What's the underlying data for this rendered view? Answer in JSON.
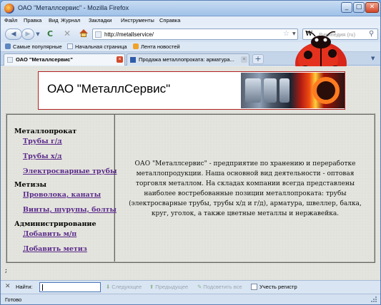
{
  "window": {
    "title": "ОАО \"Металлсервис\" - Mozilla Firefox",
    "minimize": "_",
    "maximize": "□",
    "close": "✕"
  },
  "menu": [
    "Файл",
    "Правка",
    "Вид",
    "Журнал",
    "Закладки",
    "Инструменты",
    "Справка"
  ],
  "nav": {
    "back": "◀",
    "forward": "▶",
    "dropdown": "▼",
    "reload": "C",
    "stop": "✕",
    "url": "http://metallservice/",
    "star": "☆",
    "url_dropdown": "▼",
    "search_engine": "W",
    "search_placeholder": "Википедия (ru)",
    "search_button": "⚲"
  },
  "bookmarks": [
    "Самые популярные",
    "Начальная страница",
    "Лента новостей"
  ],
  "tabs": [
    {
      "label": "ОАО \"Металлсервис\"",
      "close": "×"
    },
    {
      "label": "Продажа металлопроката: арматура...",
      "close": "×"
    }
  ],
  "new_tab": "+",
  "tab_list": "▼",
  "page": {
    "company": "ОАО \"МеталлСервис\"",
    "sidebar": {
      "cat_metalprokat": "Металлопрокат",
      "link_pipes_gd": "Трубы г/д",
      "link_pipes_hd": "Трубы х/д",
      "link_welded": "Электросварные трубы",
      "cat_metizy": "Метизы",
      "link_wire": "Проволока, канаты",
      "link_screws": "Винты, шурупы, болты",
      "cat_admin": "Администрирование",
      "link_add_mp": "Добавить м/п",
      "link_add_metiz": "Добавить метиз"
    },
    "intro": "ОАО \"Металлсервис\" - предприятие по хранению и переработке металлопродукции. Наша основной вид деятельности - оптовая торговля металлом. На складах компании всегда представлены наиболее востребованные позиции металлопроката: трубы (электросварные трубы, трубы х/д и г/д), арматура, швеллер, балка, круг, уголок, а также цветные металлы и нержавейка.",
    "trailing": ";"
  },
  "findbar": {
    "close": "✕",
    "label": "Найти:",
    "value": "",
    "next": "Следующее",
    "prev": "Предыдущее",
    "highlight": "Подсветить все",
    "match_case": "Учесть регистр"
  },
  "status": {
    "text": "Готово"
  }
}
